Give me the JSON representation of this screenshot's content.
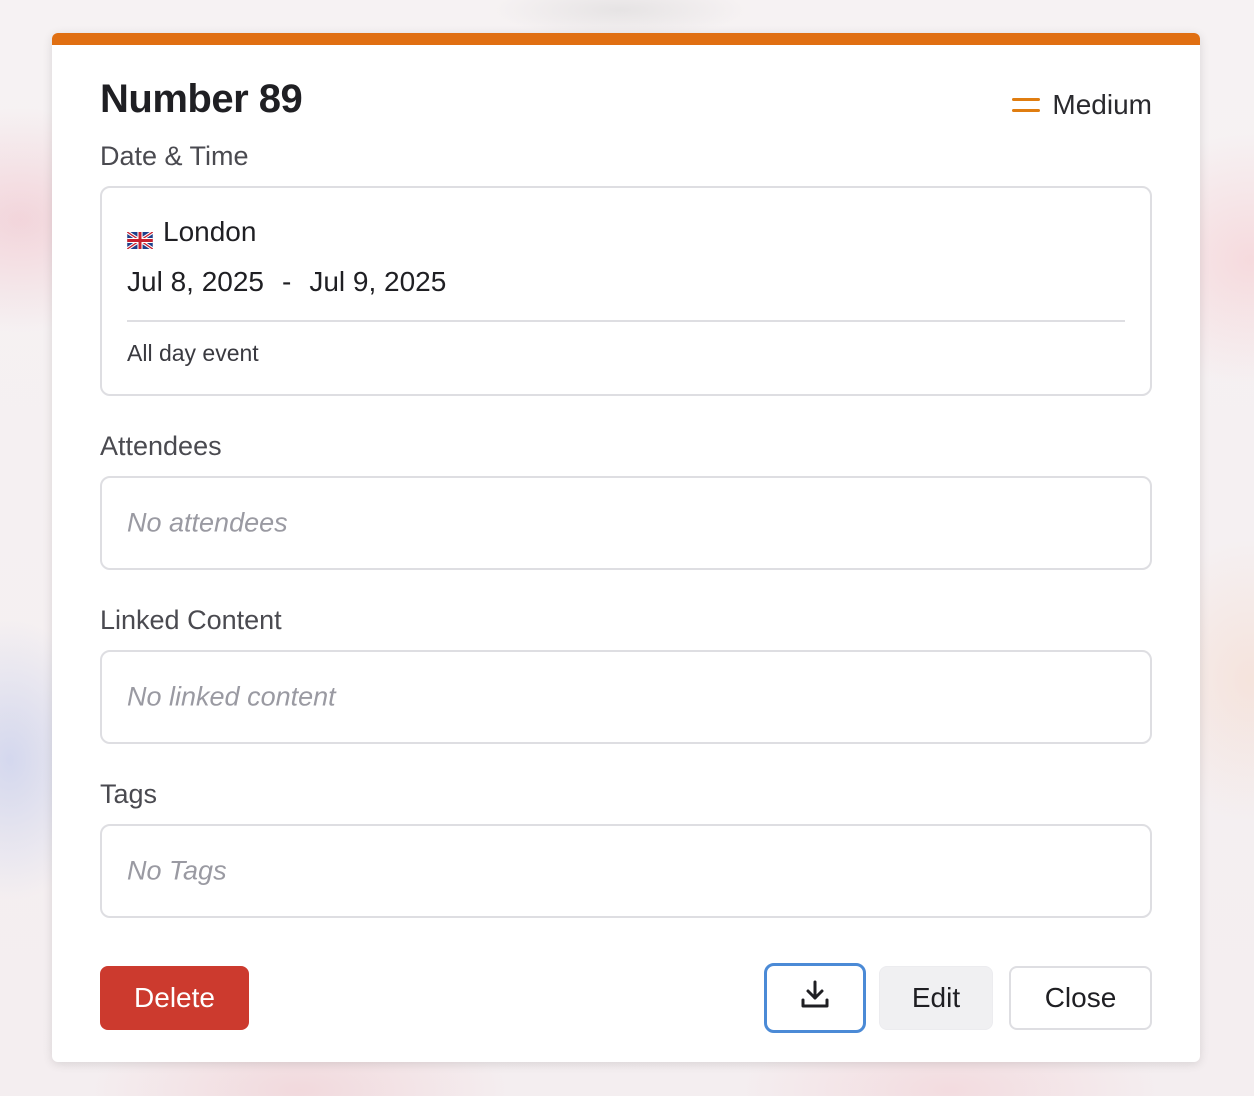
{
  "event": {
    "title": "Number 89",
    "priority": {
      "label": "Medium",
      "icon": "equals-priority-icon",
      "color": "#e07d10"
    },
    "accent_color": "#e06f12"
  },
  "date_time": {
    "label": "Date & Time",
    "location": "London",
    "flag_icon": "uk-flag-icon",
    "start_date": "Jul 8, 2025",
    "separator": "-",
    "end_date": "Jul 9, 2025",
    "all_day_text": "All day event"
  },
  "attendees": {
    "label": "Attendees",
    "empty_text": "No attendees"
  },
  "linked_content": {
    "label": "Linked Content",
    "empty_text": "No linked content"
  },
  "tags": {
    "label": "Tags",
    "empty_text": "No Tags"
  },
  "actions": {
    "delete_label": "Delete",
    "download_icon": "download-icon",
    "edit_label": "Edit",
    "close_label": "Close",
    "delete_color": "#cc3a2e",
    "focus_color": "#4b8ad6"
  }
}
